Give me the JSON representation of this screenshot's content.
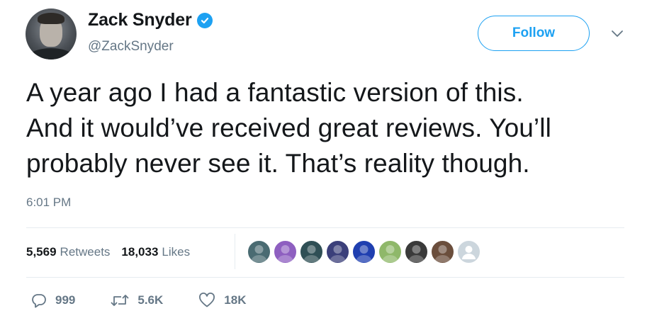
{
  "user": {
    "display_name": "Zack Snyder",
    "handle": "@ZackSnyder",
    "verified": true,
    "avatar_icon": "profile-photo"
  },
  "follow_button": {
    "label": "Follow",
    "color": "#1da1f2"
  },
  "tweet": {
    "lines": [
      "A year ago I had a fantastic version of this.",
      "And it would’ve received great reviews. You’ll",
      "probably never see it. That’s reality though."
    ],
    "time": "6:01 PM"
  },
  "stats": {
    "retweets": {
      "count": "5,569",
      "label": "Retweets"
    },
    "likes": {
      "count": "18,033",
      "label": "Likes"
    }
  },
  "likers": [
    {
      "icon": "user-avatar",
      "color": "#4a6b72"
    },
    {
      "icon": "user-avatar",
      "color": "#8e5fc0"
    },
    {
      "icon": "user-avatar",
      "color": "#2f4f55"
    },
    {
      "icon": "user-avatar",
      "color": "#3b3f7a"
    },
    {
      "icon": "user-avatar",
      "color": "#1f3fb0"
    },
    {
      "icon": "user-avatar",
      "color": "#8fb86a"
    },
    {
      "icon": "user-avatar",
      "color": "#3a3a3a"
    },
    {
      "icon": "user-avatar",
      "color": "#6b4e3c"
    },
    {
      "icon": "default-avatar",
      "color": "#ccd6dd"
    }
  ],
  "actions": {
    "reply": {
      "icon": "reply-icon",
      "count": "999"
    },
    "retweet": {
      "icon": "retweet-icon",
      "count": "5.6K"
    },
    "like": {
      "icon": "heart-icon",
      "count": "18K"
    }
  },
  "colors": {
    "accent": "#1da1f2",
    "secondary_text": "#657786",
    "primary_text": "#14171a",
    "divider": "#e6ecf0"
  }
}
